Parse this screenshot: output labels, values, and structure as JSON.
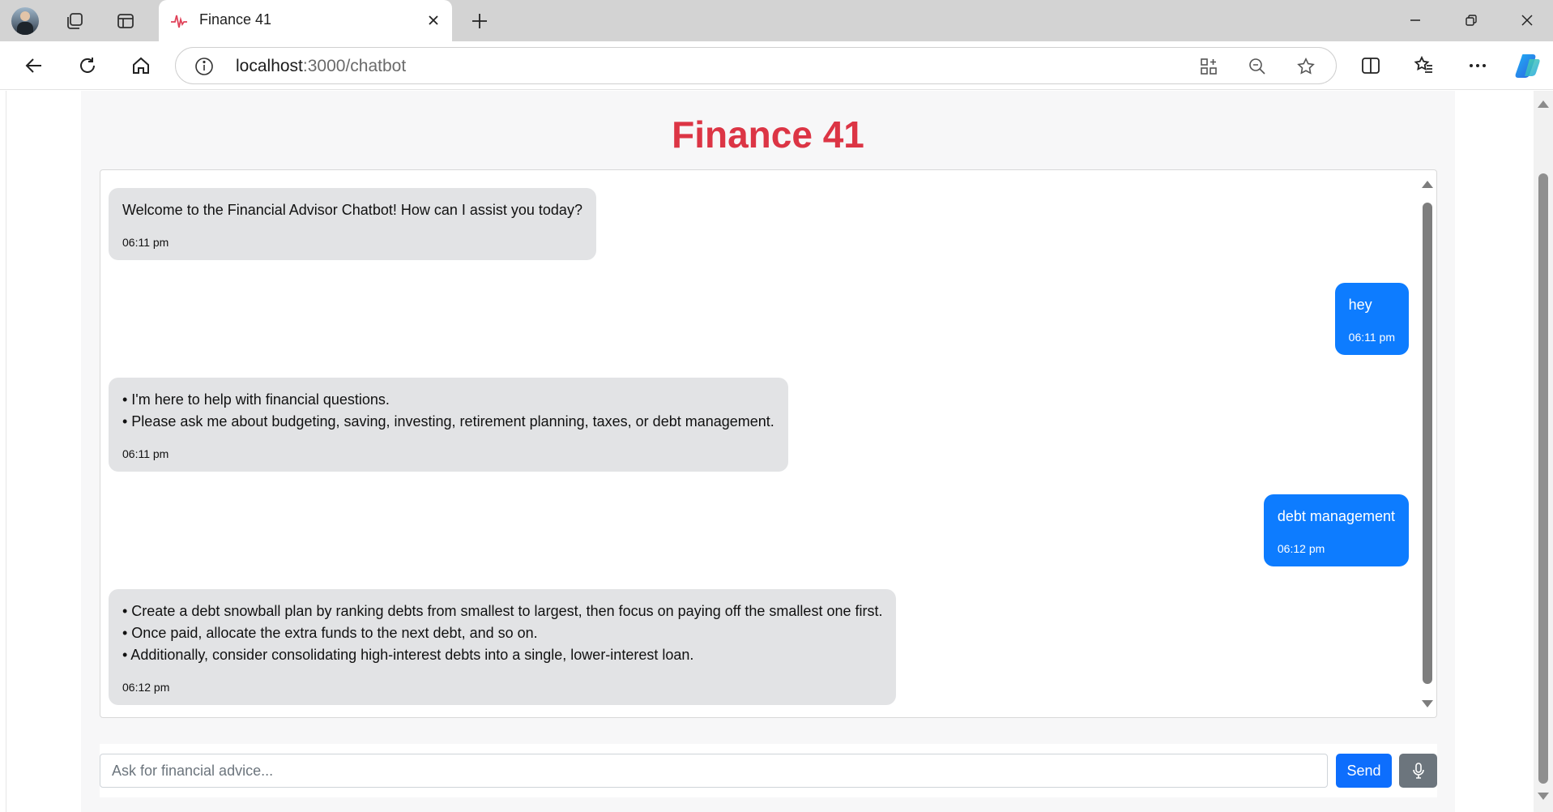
{
  "browser": {
    "tab_title": "Finance 41",
    "url_host": "localhost",
    "url_path": ":3000/chatbot"
  },
  "app": {
    "title": "Finance 41",
    "title_color": "#dc3545",
    "user_bubble_color": "#0d7cff",
    "bot_bubble_color": "#e2e3e5"
  },
  "messages": [
    {
      "sender": "bot",
      "lines": [
        "Welcome to the Financial Advisor Chatbot! How can I assist you today?"
      ],
      "time": "06:11 pm"
    },
    {
      "sender": "user",
      "lines": [
        "hey"
      ],
      "time": "06:11 pm"
    },
    {
      "sender": "bot",
      "lines": [
        "• I'm here to help with financial questions.",
        "• Please ask me about budgeting, saving, investing, retirement planning, taxes, or debt management."
      ],
      "time": "06:11 pm"
    },
    {
      "sender": "user",
      "lines": [
        "debt management"
      ],
      "time": "06:12 pm"
    },
    {
      "sender": "bot",
      "lines": [
        "• Create a debt snowball plan by ranking debts from smallest to largest, then focus on paying off the smallest one first.",
        "• Once paid, allocate the extra funds to the next debt, and so on.",
        "• Additionally, consider consolidating high-interest debts into a single, lower-interest loan."
      ],
      "time": "06:12 pm"
    }
  ],
  "composer": {
    "placeholder": "Ask for financial advice...",
    "value": "",
    "send_label": "Send",
    "mic_icon": "microphone-icon"
  }
}
